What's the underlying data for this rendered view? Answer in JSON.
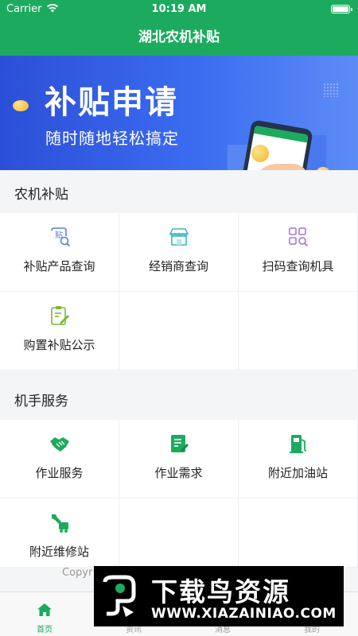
{
  "status_bar": {
    "carrier": "Carrier",
    "time": "10:19 AM"
  },
  "nav": {
    "title": "湖北农机补贴"
  },
  "banner": {
    "title": "补贴申请",
    "subtitle": "随时随地轻松搞定"
  },
  "sections": [
    {
      "title": "农机补贴",
      "items": [
        {
          "label": "补贴产品查询",
          "icon": "subsidy-search-icon"
        },
        {
          "label": "经销商查询",
          "icon": "store-icon"
        },
        {
          "label": "扫码查询机具",
          "icon": "qr-scan-icon"
        },
        {
          "label": "购置补贴公示",
          "icon": "clipboard-edit-icon"
        }
      ]
    },
    {
      "title": "机手服务",
      "items": [
        {
          "label": "作业服务",
          "icon": "handshake-icon"
        },
        {
          "label": "作业需求",
          "icon": "document-edit-icon"
        },
        {
          "label": "附近加油站",
          "icon": "gas-station-icon"
        },
        {
          "label": "附近维修站",
          "icon": "repair-icon"
        }
      ]
    }
  ],
  "footer": {
    "copyright_partial": "Copyr"
  },
  "tabs": [
    {
      "label": "首页",
      "icon": "home-icon",
      "active": true
    },
    {
      "label": "资讯",
      "icon": "news-icon",
      "active": false
    },
    {
      "label": "消息",
      "icon": "message-icon",
      "active": false
    },
    {
      "label": "我的",
      "icon": "profile-icon",
      "active": false
    }
  ],
  "watermark": {
    "title": "下载鸟资源",
    "url": "WWW.XIAZAINIAO.COM"
  },
  "colors": {
    "primary": "#1cab5e",
    "banner_blue": "#2c4fd8",
    "section_bg": "#f3f5f6"
  }
}
